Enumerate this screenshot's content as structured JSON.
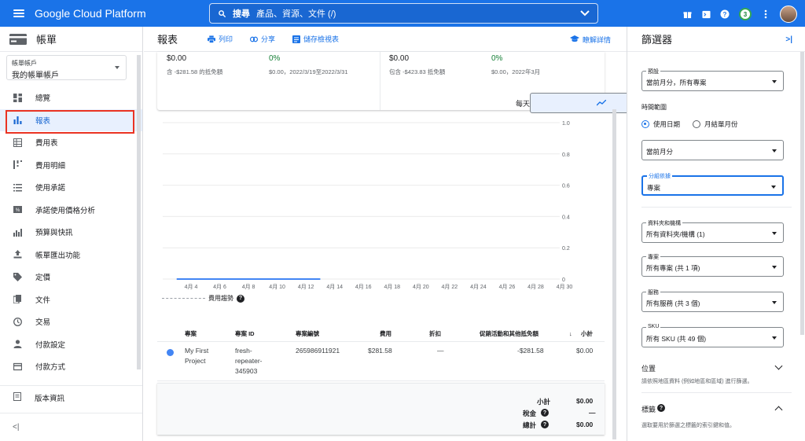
{
  "topbar": {
    "brand": "Google Cloud Platform",
    "search_label": "搜尋",
    "search_placeholder": "產品、資源、文件 (/)",
    "notification_count": "3"
  },
  "sidebar": {
    "title": "帳單",
    "account_label": "帳單帳戶",
    "account_value": "我的帳單帳戶",
    "items": [
      {
        "label": "總覽",
        "icon": "dashboard-icon"
      },
      {
        "label": "報表",
        "icon": "bar-chart-icon"
      },
      {
        "label": "費用表",
        "icon": "table-icon"
      },
      {
        "label": "費用明細",
        "icon": "breakdown-icon"
      },
      {
        "label": "使用承諾",
        "icon": "list-icon"
      },
      {
        "label": "承諾使用價格分析",
        "icon": "price-analysis-icon"
      },
      {
        "label": "預算與快訊",
        "icon": "budget-icon"
      },
      {
        "label": "帳單匯出功能",
        "icon": "upload-icon"
      },
      {
        "label": "定價",
        "icon": "tag-icon"
      },
      {
        "label": "文件",
        "icon": "document-icon"
      },
      {
        "label": "交易",
        "icon": "clock-icon"
      },
      {
        "label": "付款設定",
        "icon": "person-icon"
      },
      {
        "label": "付款方式",
        "icon": "credit-card-icon"
      }
    ],
    "release_notes": "版本資訊",
    "collapse": "<|"
  },
  "main": {
    "title": "報表",
    "print": "列印",
    "share": "分享",
    "save_view": "儲存檢視表",
    "learn_more": "瞭解詳情",
    "summary": [
      {
        "value": "$0.00",
        "sub": "含 -$281.58 的抵免額",
        "pct": "0%",
        "pct_sub": "$0.00，2022/3/19至2022/3/31"
      },
      {
        "value": "$0.00",
        "sub": "包含 -$423.83 抵免額",
        "pct": "0%",
        "pct_sub": "$0.00，2022年3月"
      }
    ],
    "granularity": "每天",
    "legend": "費用趨勢",
    "table": {
      "headers": [
        "專案",
        "專案 ID",
        "專案編號",
        "費用",
        "折扣",
        "促銷活動和其他抵免額",
        "小計"
      ],
      "row": {
        "project_line1": "My First",
        "project_line2": "Project",
        "id_line1": "fresh-",
        "id_line2": "repeater-",
        "id_line3": "345903",
        "number": "265986911921",
        "cost": "$281.58",
        "discount": "—",
        "credits": "-$281.58",
        "subtotal": "$0.00"
      },
      "totals": [
        {
          "label": "小計",
          "value": "$0.00"
        },
        {
          "label": "稅金",
          "value": "—"
        },
        {
          "label": "總計",
          "value": "$0.00"
        }
      ]
    }
  },
  "chart_data": {
    "type": "line",
    "categories": [
      "4月 4",
      "4月 6",
      "4月 8",
      "4月 10",
      "4月 12",
      "4月 14",
      "4月 16",
      "4月 18",
      "4月 20",
      "4月 22",
      "4月 24",
      "4月 26",
      "4月 28",
      "4月 30"
    ],
    "series": [
      {
        "x": [
          "4月 3",
          "4月 13"
        ],
        "values": [
          0,
          0
        ]
      }
    ],
    "yticks": [
      "0",
      "0.2",
      "0.4",
      "0.6",
      "0.8",
      "1.0"
    ],
    "ylim": [
      0,
      1.0
    ],
    "grid": true
  },
  "filters": {
    "title": "篩選器",
    "preset_label": "預設",
    "preset_value": "當前月分，所有專案",
    "time_range": "時間範圍",
    "radio_usage": "使用日期",
    "radio_invoice": "月結單月份",
    "month_value": "當前月分",
    "group_label": "分組依據",
    "group_value": "專案",
    "folder_label": "資料夾和機構",
    "folder_value": "所有資料夾/機構 (1)",
    "project_label": "專案",
    "project_value": "所有專案 (共 1 項)",
    "service_label": "服務",
    "service_value": "所有服務 (共 3 個)",
    "sku_label": "SKU",
    "sku_value": "所有 SKU (共 49 個)",
    "location_title": "位置",
    "location_desc": "請依照地區資料 (例如地區和區域) 進行篩選。",
    "labels_title": "標籤",
    "labels_desc": "選取要用於篩選之標籤的索引鍵和值。"
  }
}
